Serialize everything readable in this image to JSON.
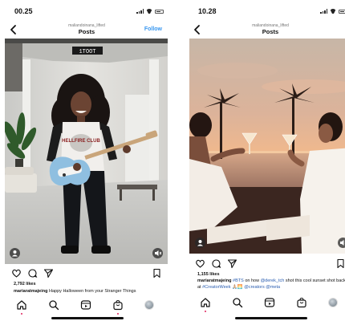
{
  "left_post": {
    "status_time": "00.25",
    "header": {
      "username": "maliandoinana_lifted",
      "title": "Posts",
      "follow_label": "Follow"
    },
    "media_overlay_text": "1TOOT",
    "shirt_text": "HELLFIRE CLUB",
    "likes": "2,792 likes",
    "caption_user": "mariaratmajeing",
    "caption_text": " Happy Halloween from your Stranger Things"
  },
  "right_post": {
    "status_time": "10.28",
    "header": {
      "username": "maliandoinana_lifted",
      "title": "Posts"
    },
    "likes": "1,155 likes",
    "caption_user": "mariaratmajeing",
    "caption_pre": " ",
    "caption_tag1": "#BTS",
    "caption_mid": " on how ",
    "caption_mention1": "@derek_tch",
    "caption_mid2": " shot this cool sunset shot back at ",
    "caption_tag2": "#CreatorWeek",
    "caption_mid3": " 🙏🏼🌅 ",
    "caption_mention2": "@creators",
    "caption_mid4": " ",
    "caption_mention3": "@meta"
  },
  "icons": [
    "back-arrow",
    "heart",
    "comment",
    "share",
    "bookmark",
    "home",
    "search",
    "reels",
    "shop",
    "profile",
    "tagged-people",
    "mute"
  ],
  "colors": {
    "follow": "#3897f0",
    "notification_dot": "#e0245e",
    "link": "#2a5db0"
  }
}
